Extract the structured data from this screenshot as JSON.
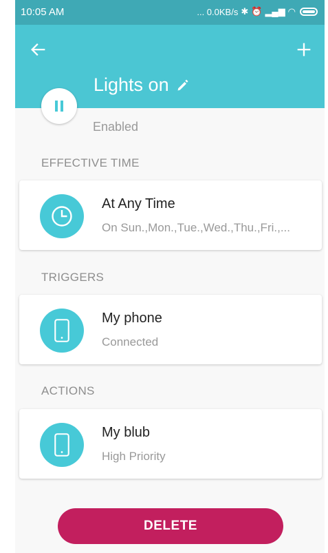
{
  "statusbar": {
    "time": "10:05 AM",
    "network": "... 0.0KB/s",
    "icons": [
      "bluetooth-icon",
      "alarm-icon",
      "signal-icon",
      "wifi-icon",
      "battery-icon"
    ]
  },
  "header": {
    "title": "Lights on",
    "status": "Enabled"
  },
  "sections": {
    "effective_time": {
      "label": "EFFECTIVE TIME",
      "title": "At Any Time",
      "subtitle": "On Sun.,Mon.,Tue.,Wed.,Thu.,Fri.,..."
    },
    "triggers": {
      "label": "TRIGGERS",
      "title": "My phone",
      "subtitle": "Connected"
    },
    "actions": {
      "label": "ACTIONS",
      "title": "My blub",
      "subtitle": "High Priority"
    }
  },
  "delete_label": "DELETE",
  "colors": {
    "header": "#4bc6d3",
    "statusbar": "#3fa9b5",
    "icon_bg": "#47c9d7",
    "delete": "#c21f5e"
  }
}
